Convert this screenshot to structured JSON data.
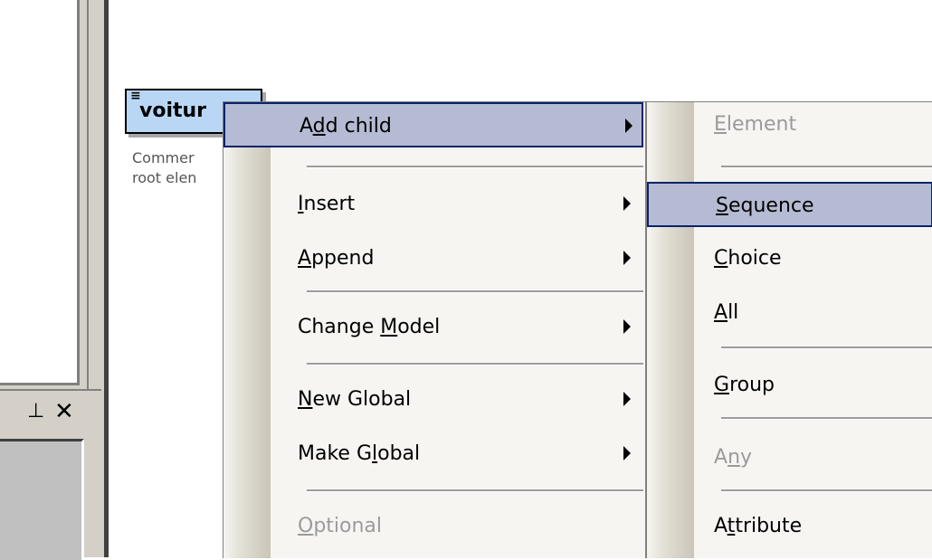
{
  "left_panel": {
    "pin_icon": "pin-icon",
    "close_icon": "close-icon",
    "pin_glyph": "⊥",
    "close_glyph": "✕"
  },
  "element_box": {
    "glyph": "≡",
    "name": "voitur",
    "comment_line1": "Commer",
    "comment_line2": "root elen"
  },
  "context_menu": {
    "items": [
      {
        "pre": "A",
        "key": "d",
        "post": "d child",
        "submenu": true,
        "highlight": true,
        "disabled": false
      },
      {
        "pre": "",
        "key": "I",
        "post": "nsert",
        "submenu": true,
        "highlight": false,
        "disabled": false
      },
      {
        "pre": "",
        "key": "A",
        "post": "ppend",
        "submenu": true,
        "highlight": false,
        "disabled": false
      },
      {
        "pre": "Change ",
        "key": "M",
        "post": "odel",
        "submenu": true,
        "highlight": false,
        "disabled": false
      },
      {
        "pre": "",
        "key": "N",
        "post": "ew Global",
        "submenu": true,
        "highlight": false,
        "disabled": false
      },
      {
        "pre": "Make G",
        "key": "l",
        "post": "obal",
        "submenu": true,
        "highlight": false,
        "disabled": false
      },
      {
        "pre": "",
        "key": "O",
        "post": "ptional",
        "submenu": false,
        "highlight": false,
        "disabled": true
      }
    ]
  },
  "submenu": {
    "items": [
      {
        "pre": "",
        "key": "E",
        "post": "lement",
        "highlight": false,
        "disabled": true
      },
      {
        "pre": "",
        "key": "S",
        "post": "equence",
        "highlight": true,
        "disabled": false
      },
      {
        "pre": "",
        "key": "C",
        "post": "hoice",
        "highlight": false,
        "disabled": false
      },
      {
        "pre": "",
        "key": "A",
        "post": "ll",
        "highlight": false,
        "disabled": false
      },
      {
        "pre": "",
        "key": "G",
        "post": "roup",
        "highlight": false,
        "disabled": false
      },
      {
        "pre": "A",
        "key": "n",
        "post": "y",
        "highlight": false,
        "disabled": true
      },
      {
        "pre": "A",
        "key": "t",
        "post": "tribute",
        "highlight": false,
        "disabled": false
      }
    ]
  },
  "colors": {
    "highlight_bg": "#b4bbd3",
    "highlight_border": "#0a246a",
    "element_bg": "#b9d7f5",
    "menu_bg": "#f6f5f1"
  }
}
